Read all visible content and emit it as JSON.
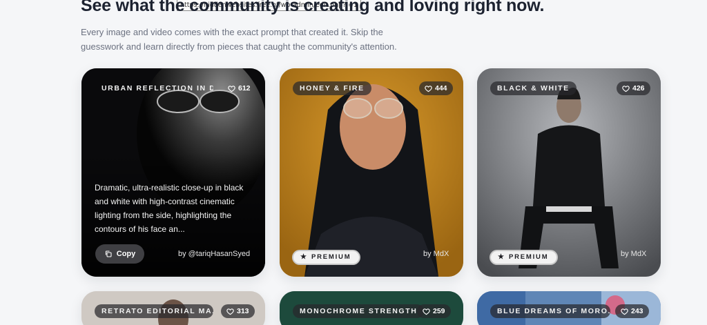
{
  "status_url": "https://hiddenwebsites.free.nf/wp-admin/edit.php?i=1",
  "section": {
    "heading": "See what the community is creating and loving right now.",
    "subtitle": "Every image and video comes with the exact prompt that created it. Skip the guesswork and learn directly from pieces that caught the community's attention."
  },
  "cards": [
    {
      "title": "URBAN REFLECTION IN D...",
      "likes": "612",
      "description": "Dramatic, ultra-realistic close-up in black and white with high-contrast cinematic lighting from the side, highlighting the contours of his face an...",
      "copy_label": "Copy",
      "author": "by @tariqHasanSyed"
    },
    {
      "title": "HONEY & FIRE",
      "likes": "444",
      "badge": "PREMIUM",
      "author": "by MdX"
    },
    {
      "title": "BLACK & WHITE",
      "likes": "426",
      "badge": "PREMIUM",
      "author": "by MdX"
    },
    {
      "title": "RETRATO EDITORIAL MA...",
      "likes": "313"
    },
    {
      "title": "MONOCHROME STRENGTH",
      "likes": "259"
    },
    {
      "title": "BLUE DREAMS OF MORO...",
      "likes": "243"
    }
  ]
}
